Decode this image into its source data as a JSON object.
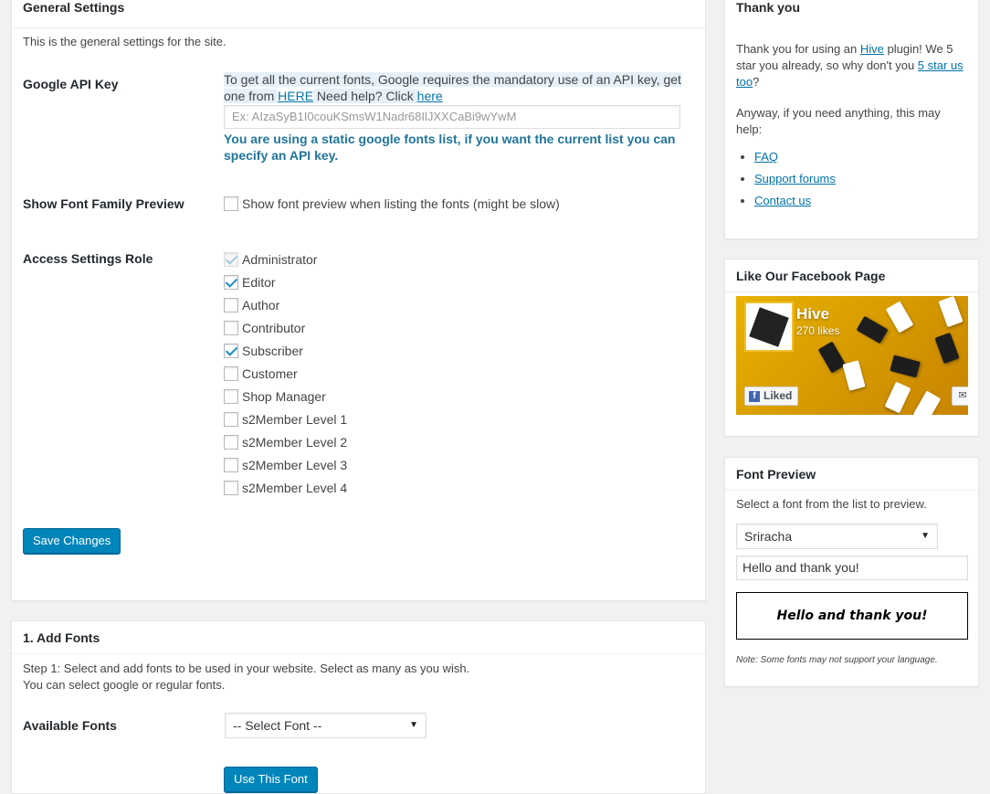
{
  "general": {
    "title": "General Settings",
    "description": "This is the general settings for the site.",
    "api_key": {
      "label": "Google API Key",
      "help_part1": "To get all the current fonts, Google requires the mandatory use of an API key, get one from ",
      "help_link1": "HERE",
      "help_part2": " Need help? Click ",
      "help_link2": "here",
      "placeholder": "Ex: AIzaSyB1I0couKSmsW1Nadr68IlJXXCaBi9wYwM",
      "notice": "You are using a static google fonts list, if you want the current list you can specify an API key."
    },
    "font_preview": {
      "label": "Show Font Family Preview",
      "checkbox_label": "Show font preview when listing the fonts (might be slow)",
      "checked": false
    },
    "access_role": {
      "label": "Access Settings Role",
      "roles": [
        {
          "name": "Administrator",
          "checked": true,
          "disabled": true
        },
        {
          "name": "Editor",
          "checked": true,
          "disabled": false
        },
        {
          "name": "Author",
          "checked": false,
          "disabled": false
        },
        {
          "name": "Contributor",
          "checked": false,
          "disabled": false
        },
        {
          "name": "Subscriber",
          "checked": true,
          "disabled": false
        },
        {
          "name": "Customer",
          "checked": false,
          "disabled": false
        },
        {
          "name": "Shop Manager",
          "checked": false,
          "disabled": false
        },
        {
          "name": "s2Member Level 1",
          "checked": false,
          "disabled": false
        },
        {
          "name": "s2Member Level 2",
          "checked": false,
          "disabled": false
        },
        {
          "name": "s2Member Level 3",
          "checked": false,
          "disabled": false
        },
        {
          "name": "s2Member Level 4",
          "checked": false,
          "disabled": false
        }
      ]
    },
    "save_label": "Save Changes"
  },
  "add_fonts": {
    "title": "1. Add Fonts",
    "step_line1": "Step 1: Select and add fonts to be used in your website. Select as many as you wish.",
    "step_line2": "You can select google or regular fonts.",
    "available_label": "Available Fonts",
    "select_value": "-- Select Font --",
    "use_label": "Use This Font"
  },
  "thanks": {
    "title": "Thank you",
    "text_part1": "Thank you for using an ",
    "text_link1": "Hive",
    "text_part2": " plugin! We 5 star you already, so why don't you ",
    "text_link2": "5 star us too",
    "text_part3": "?",
    "text2": "Anyway, if you need anything, this may help:",
    "links": [
      "FAQ",
      "Support forums",
      "Contact us"
    ]
  },
  "facebook": {
    "title": "Like Our Facebook Page",
    "page_name": "Hive",
    "likes": "270 likes",
    "liked_label": "Liked"
  },
  "preview": {
    "title": "Font Preview",
    "instruction": "Select a font from the list to preview.",
    "selected_font": "Sriracha",
    "sample_text": "Hello and thank you!",
    "output": "Hello and thank you!",
    "note": "Note: Some fonts may not support your language."
  },
  "colors": {
    "primary_button": "#0085ba",
    "link": "#0073aa",
    "notice": "#21759b",
    "background": "#f1f1f1"
  }
}
